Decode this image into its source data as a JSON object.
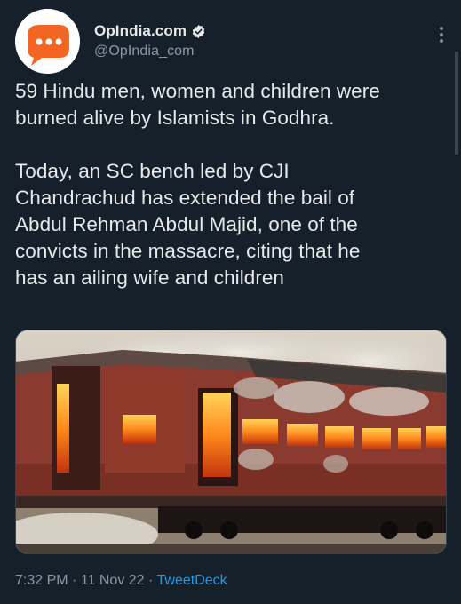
{
  "author": {
    "display_name": "OpIndia.com",
    "handle": "@OpIndia_com",
    "avatar_icon": "speech-bubble-icon",
    "verified_icon": "verified-badge-icon"
  },
  "tweet": {
    "paragraph1": [
      "59 Hindu men, women and children were",
      "burned alive by Islamists in Godhra."
    ],
    "paragraph2": [
      "Today, an SC bench led by CJI",
      "Chandrachud has extended the bail of",
      "Abdul Rehman Abdul Majid, one of the",
      "convicts in the massacre, citing that he",
      "has an ailing wife and children"
    ]
  },
  "meta": {
    "time": "7:32 PM",
    "separator1": " · ",
    "date": "11 Nov 22",
    "separator2": " · ",
    "source": "TweetDeck"
  },
  "colors": {
    "background": "#15202b",
    "text": "#e7e9ea",
    "secondary": "#8b98a5",
    "link": "#1d9bf0",
    "brand_orange": "#f26522"
  }
}
